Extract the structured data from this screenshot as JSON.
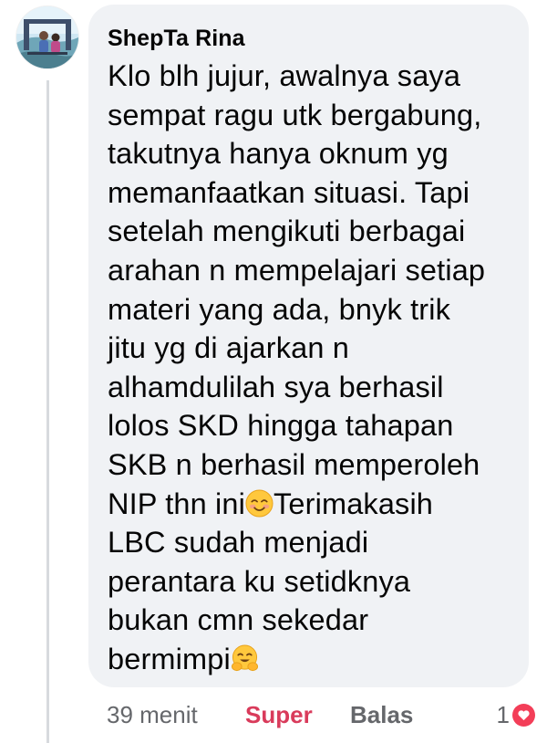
{
  "comment": {
    "author": "ShepTa Rina",
    "lines": [
      "Klo blh jujur, awalnya saya",
      "sempat ragu utk bergabung,",
      "takutnya hanya oknum yg",
      "memanfaatkan situasi. Tapi",
      "setelah mengikuti berbagai",
      "arahan n mempelajari setiap",
      "materi yang ada, bnyk trik",
      "jitu yg di ajarkan n",
      "alhamdulilah sya berhasil",
      "lolos SKD hingga tahapan",
      "SKB n berhasil memperoleh"
    ],
    "line12_before_emoji": "NIP thn ini",
    "line12_after_emoji": "Terimakasih",
    "lines_end": [
      "LBC sudah menjadi",
      "perantara ku setidknya",
      "bukan cmn sekedar"
    ],
    "last_line_text": "bermimpi",
    "emojis": [
      "smiling-face-with-blush-emoji",
      "hugging-face-emoji"
    ]
  },
  "actions": {
    "timestamp": "39 menit",
    "reaction_label": "Super",
    "reply_label": "Balas",
    "reaction_count": "1",
    "reaction_icon": "heart-icon"
  },
  "colors": {
    "bubble_bg": "#f0f2f5",
    "text": "#050505",
    "muted": "#65676b",
    "super_reaction": "#d93b5b",
    "heart": "#f33e58"
  }
}
